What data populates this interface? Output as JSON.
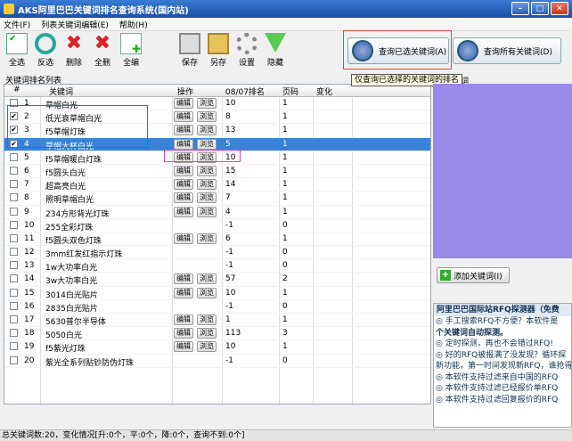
{
  "window": {
    "title": "AKS阿里巴巴关键词排名查询系统(国内站)"
  },
  "menu": [
    "文件(F)",
    "列表关键词编辑(E)",
    "帮助(H)"
  ],
  "toolbar": {
    "select_all": "全选",
    "invert": "反选",
    "delete": "删除",
    "delete_all": "全删",
    "edit_all": "全编",
    "save": "保存",
    "save_as": "另存",
    "settings": "设置",
    "hide": "隐藏",
    "query_selected": "查询已选关键词(A)",
    "query_all": "查询所有关键词(D)"
  },
  "tooltip": "仅查询已选择的关键词的排名",
  "list_title": "关键词排名列表",
  "right_panel_label": "键词",
  "columns": {
    "num": "#",
    "keyword": "关键词",
    "action": "操作",
    "rank": "08/07排名",
    "page": "页码",
    "change": "变化"
  },
  "btn_edit": "编辑",
  "btn_browse": "浏览",
  "rows": [
    {
      "n": "1",
      "kw": "草帽白光",
      "rank": "10",
      "page": "1",
      "checked": false,
      "edit": true
    },
    {
      "n": "2",
      "kw": "低光衰草帽白光",
      "rank": "8",
      "page": "1",
      "checked": true,
      "edit": true
    },
    {
      "n": "3",
      "kw": "f5草帽灯珠",
      "rank": "13",
      "page": "1",
      "checked": true,
      "edit": true
    },
    {
      "n": "4",
      "kw": "草帽大杯白光",
      "rank": "5",
      "page": "1",
      "checked": true,
      "edit": true,
      "selected": true
    },
    {
      "n": "5",
      "kw": "f5草帽暖白灯珠",
      "rank": "10",
      "page": "1",
      "checked": false,
      "edit": true
    },
    {
      "n": "6",
      "kw": "f5圆头白光",
      "rank": "15",
      "page": "1",
      "checked": false,
      "edit": true
    },
    {
      "n": "7",
      "kw": "超高亮白光",
      "rank": "14",
      "page": "1",
      "checked": false,
      "edit": true
    },
    {
      "n": "8",
      "kw": "照明草帽白光",
      "rank": "7",
      "page": "1",
      "checked": false,
      "edit": true
    },
    {
      "n": "9",
      "kw": "234方形背光灯珠",
      "rank": "4",
      "page": "1",
      "checked": false,
      "edit": true
    },
    {
      "n": "10",
      "kw": "255全彩灯珠",
      "rank": "-1",
      "page": "0",
      "checked": false,
      "edit": false
    },
    {
      "n": "11",
      "kw": "f5圆头双色灯珠",
      "rank": "6",
      "page": "1",
      "checked": false,
      "edit": true
    },
    {
      "n": "12",
      "kw": "3mm红发红指示灯珠",
      "rank": "-1",
      "page": "0",
      "checked": false,
      "edit": false
    },
    {
      "n": "13",
      "kw": "1w大功率白光",
      "rank": "-1",
      "page": "0",
      "checked": false,
      "edit": false
    },
    {
      "n": "14",
      "kw": "3w大功率白光",
      "rank": "57",
      "page": "2",
      "checked": false,
      "edit": true
    },
    {
      "n": "15",
      "kw": "3014白光贴片",
      "rank": "10",
      "page": "1",
      "checked": false,
      "edit": true
    },
    {
      "n": "16",
      "kw": "2835白光贴片",
      "rank": "-1",
      "page": "0",
      "checked": false,
      "edit": false
    },
    {
      "n": "17",
      "kw": "5630普尔半导体",
      "rank": "1",
      "page": "1",
      "checked": false,
      "edit": true
    },
    {
      "n": "18",
      "kw": "5050白光",
      "rank": "113",
      "page": "3",
      "checked": false,
      "edit": true
    },
    {
      "n": "19",
      "kw": "f5紫光灯珠",
      "rank": "10",
      "page": "1",
      "checked": false,
      "edit": true
    },
    {
      "n": "20",
      "kw": "紫光全系列贴钞防伪灯珠",
      "rank": "-1",
      "page": "0",
      "checked": false,
      "edit": false
    }
  ],
  "add_keyword": "添加关键词(I)",
  "ad": {
    "header": "阿里巴巴国际站RFQ探测器（免费",
    "lines": [
      {
        "t": "◎ 手工搜索RFQ不方便？本软件是",
        "red": false
      },
      {
        "t": "个关键词自动探测。",
        "red": true
      },
      {
        "t": "◎ 定时探测，再也不会错过RFQ!",
        "red": false
      },
      {
        "t": "◎ 好的RFQ被报满了没发现？循环探",
        "red": false
      },
      {
        "t": "新功能，第一时间发现新RFQ，谁抢得",
        "red": false
      },
      {
        "t": "◎ 本软件支持过滤来自中国的RFQ",
        "red": false
      },
      {
        "t": "◎ 本软件支持过滤已经报价单RFQ",
        "red": false
      },
      {
        "t": "◎ 本软件支持过滤回复报价的RFQ",
        "red": false
      }
    ]
  },
  "status": "总关键词数:20，变化情况[升:0个，平:0个，降:0个，查询不到:0个]"
}
